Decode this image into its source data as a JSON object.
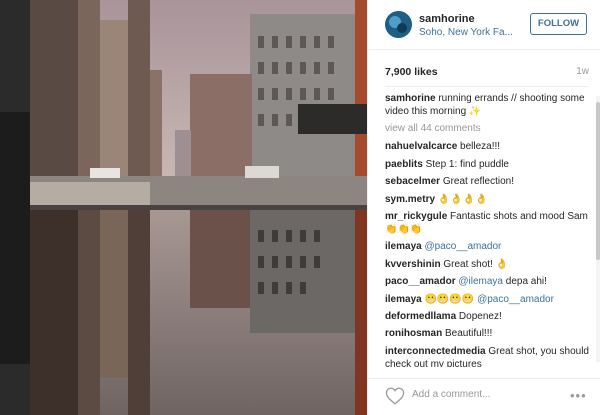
{
  "post": {
    "username": "samhorine",
    "location": "Soho, New York Fa...",
    "follow_label": "FOLLOW",
    "likes": "7,900 likes",
    "age": "1w",
    "caption_user": "samhorine",
    "caption_text": " running errands // shooting some video this morning ✨",
    "view_all": "view all 44 comments",
    "add_comment_placeholder": "Add a comment...",
    "more_label": "•••"
  },
  "comments": [
    {
      "user": "nahuelvalcarce",
      "text": " belleza!!!",
      "mention": ""
    },
    {
      "user": "paeblits",
      "text": " Step 1: find puddle",
      "mention": ""
    },
    {
      "user": "sebacelmer",
      "text": " Great reflection!",
      "mention": ""
    },
    {
      "user": "sym.metry",
      "text": " 👌👌👌👌",
      "mention": ""
    },
    {
      "user": "mr_rickygule",
      "text": " Fantastic shots and mood Sam 👏👏👏",
      "mention": ""
    },
    {
      "user": "ilemaya",
      "text": " ",
      "mention": "@paco__amador"
    },
    {
      "user": "kvvershinin",
      "text": " Great shot! 👌",
      "mention": ""
    },
    {
      "user": "paco__amador",
      "text": " depa ahi!",
      "mention": "@ilemaya"
    },
    {
      "user": "ilemaya",
      "text": " 😬😬😬😬 ",
      "mention": "@paco__amador"
    },
    {
      "user": "deformedllama",
      "text": " Dopenez!",
      "mention": ""
    },
    {
      "user": "ronihosman",
      "text": " Beautiful!!!",
      "mention": ""
    },
    {
      "user": "interconnectedmedia",
      "text": " Great shot, you should check out my pictures",
      "mention": ""
    }
  ],
  "icons": {
    "heart": "heart-icon",
    "more": "more-options-icon",
    "avatar": "avatar"
  },
  "colors": {
    "link_blue": "#3f729b",
    "text_dark": "#262626",
    "muted": "#999999",
    "divider": "#efefef"
  }
}
